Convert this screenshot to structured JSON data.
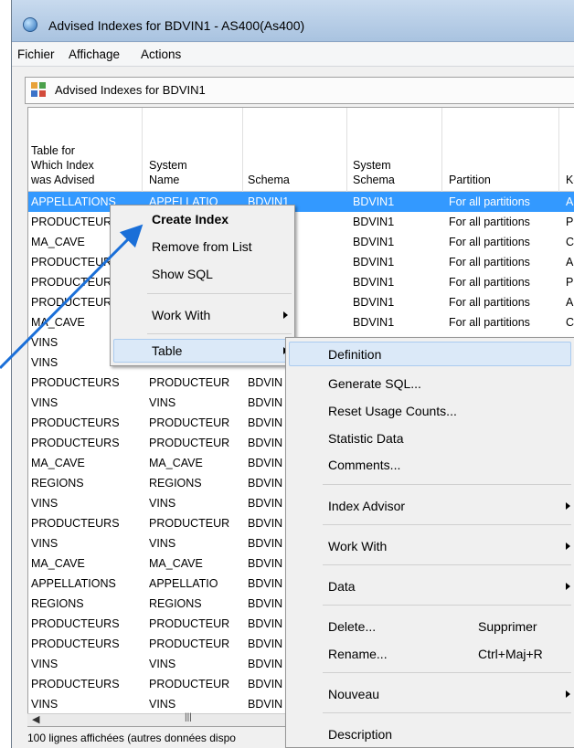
{
  "window": {
    "title": "Advised Indexes for BDVIN1 - AS400(As400)"
  },
  "menubar": {
    "items": [
      "Fichier",
      "Affichage",
      "Actions"
    ]
  },
  "frame": {
    "caption": "Advised Indexes for BDVIN1"
  },
  "table": {
    "columns": [
      "Table for\nWhich Index\nwas Advised",
      "System\nName",
      "Schema",
      "System\nSchema",
      "Partition",
      "Ke"
    ],
    "rows": [
      [
        "APPELLATIONS",
        "APPELLATIO",
        "BDVIN1",
        "BDVIN1",
        "For all partitions",
        "AP"
      ],
      [
        "PRODUCTEURS",
        "",
        "",
        "BDVIN1",
        "For all partitions",
        "PR"
      ],
      [
        "MA_CAVE",
        "",
        "",
        "BDVIN1",
        "For all partitions",
        "CA"
      ],
      [
        "PRODUCTEURS",
        "",
        "",
        "BDVIN1",
        "For all partitions",
        "AP"
      ],
      [
        "PRODUCTEURS",
        "",
        "",
        "BDVIN1",
        "For all partitions",
        "PR"
      ],
      [
        "PRODUCTEURS",
        "",
        "",
        "BDVIN1",
        "For all partitions",
        "AP"
      ],
      [
        "MA_CAVE",
        "",
        "",
        "BDVIN1",
        "For all partitions",
        "CA"
      ],
      [
        "VINS",
        "",
        "",
        "",
        "",
        ""
      ],
      [
        "VINS",
        "",
        "",
        "",
        "",
        ""
      ],
      [
        "PRODUCTEURS",
        "PRODUCTEUR",
        "BDVIN",
        "",
        "",
        ""
      ],
      [
        "VINS",
        "VINS",
        "BDVIN",
        "",
        "",
        ""
      ],
      [
        "PRODUCTEURS",
        "PRODUCTEUR",
        "BDVIN",
        "",
        "",
        ""
      ],
      [
        "PRODUCTEURS",
        "PRODUCTEUR",
        "BDVIN",
        "",
        "",
        ""
      ],
      [
        "MA_CAVE",
        "MA_CAVE",
        "BDVIN",
        "",
        "",
        ""
      ],
      [
        "REGIONS",
        "REGIONS",
        "BDVIN",
        "",
        "",
        ""
      ],
      [
        "VINS",
        "VINS",
        "BDVIN",
        "",
        "",
        ""
      ],
      [
        "PRODUCTEURS",
        "PRODUCTEUR",
        "BDVIN",
        "",
        "",
        ""
      ],
      [
        "VINS",
        "VINS",
        "BDVIN",
        "",
        "",
        ""
      ],
      [
        "MA_CAVE",
        "MA_CAVE",
        "BDVIN",
        "",
        "",
        ""
      ],
      [
        "APPELLATIONS",
        "APPELLATIO",
        "BDVIN",
        "",
        "",
        ""
      ],
      [
        "REGIONS",
        "REGIONS",
        "BDVIN",
        "",
        "",
        ""
      ],
      [
        "PRODUCTEURS",
        "PRODUCTEUR",
        "BDVIN",
        "",
        "",
        ""
      ],
      [
        "PRODUCTEURS",
        "PRODUCTEUR",
        "BDVIN",
        "",
        "",
        ""
      ],
      [
        "VINS",
        "VINS",
        "BDVIN",
        "",
        "",
        ""
      ],
      [
        "PRODUCTEURS",
        "PRODUCTEUR",
        "BDVIN",
        "",
        "",
        ""
      ],
      [
        "VINS",
        "VINS",
        "BDVIN",
        "",
        "",
        ""
      ]
    ]
  },
  "status": {
    "text": "100 lignes affichées (autres données dispo"
  },
  "context_menu": {
    "items": [
      "Create Index",
      "Remove from List",
      "Show SQL",
      "Work With",
      "Table"
    ]
  },
  "submenu": {
    "items": [
      "Definition",
      "Generate SQL...",
      "Reset Usage Counts...",
      "Statistic Data",
      "Comments...",
      "Index Advisor",
      "Work With",
      "Data",
      "Delete...",
      "Rename...",
      "Nouveau",
      "Description"
    ],
    "delete_shortcut": "Supprimer",
    "rename_shortcut": "Ctrl+Maj+R"
  },
  "colors": {
    "selection": "#3399ff",
    "arrow": "#1a6fd8",
    "titlebar": "#b9cfe8",
    "menu_highlight": "#dbe9f8"
  }
}
